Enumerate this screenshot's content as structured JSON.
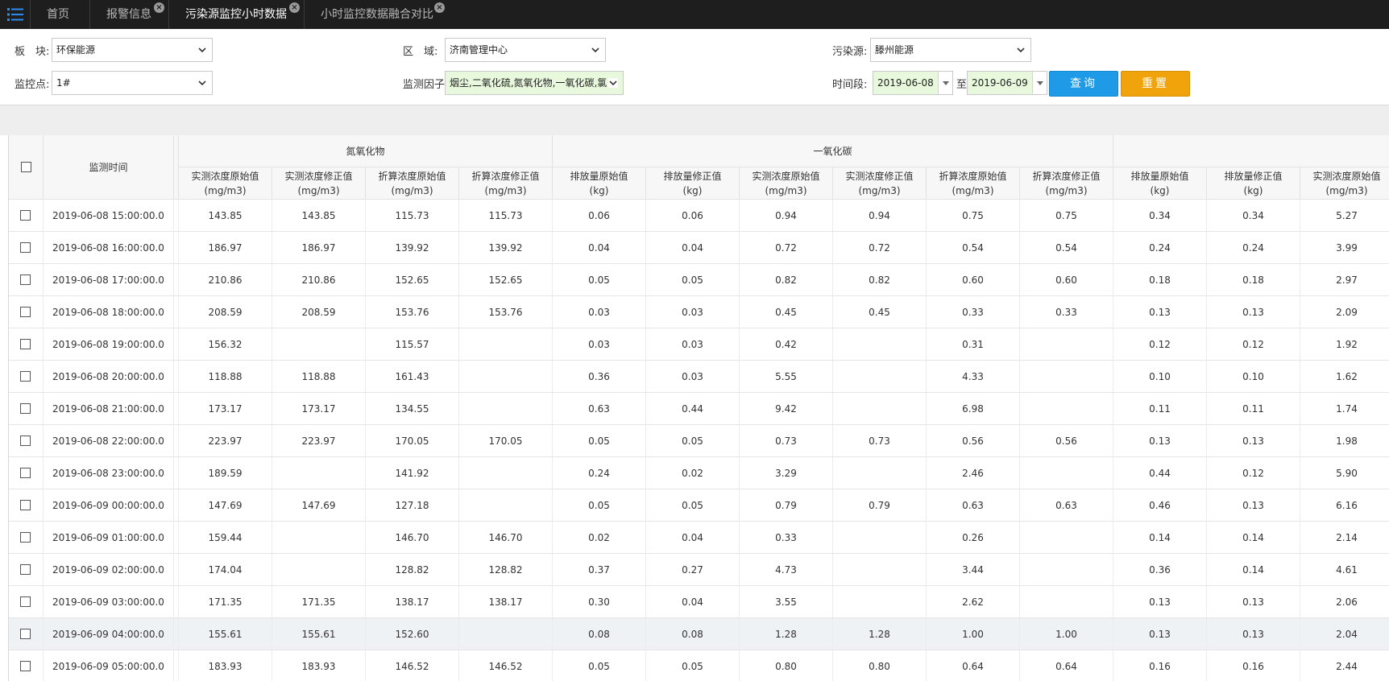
{
  "tabs": [
    {
      "label": "首页",
      "closable": false
    },
    {
      "label": "报警信息",
      "closable": true
    },
    {
      "label": "污染源监控小时数据",
      "closable": true,
      "active": true
    },
    {
      "label": "小时监控数据融合对比",
      "closable": true
    }
  ],
  "filters": {
    "plate_label": "板　块:",
    "plate_value": "环保能源",
    "region_label": "区　域:",
    "region_value": "济南管理中心",
    "source_label": "污染源:",
    "source_value": "滕州能源",
    "point_label": "监控点:",
    "point_value": "1#",
    "factor_label": "监测因子:",
    "factor_value": "烟尘,二氧化硫,氮氧化物,一氧化碳,氯",
    "time_label": "时间段:",
    "date_from": "2019-06-08",
    "date_to_label": "至",
    "date_to": "2019-06-09",
    "query_btn": "查询",
    "reset_btn": "重置"
  },
  "table": {
    "time_header": "监测时间",
    "groups": [
      {
        "name": "氮氧化物"
      },
      {
        "name": "一氧化碳"
      }
    ],
    "columns": [
      {
        "l1": "实测浓度原始值",
        "l2": "(mg/m3)"
      },
      {
        "l1": "实测浓度修正值",
        "l2": "(mg/m3)"
      },
      {
        "l1": "折算浓度原始值",
        "l2": "(mg/m3)"
      },
      {
        "l1": "折算浓度修正值",
        "l2": "(mg/m3)"
      },
      {
        "l1": "排放量原始值",
        "l2": "(kg)"
      },
      {
        "l1": "排放量修正值",
        "l2": "(kg)"
      },
      {
        "l1": "实测浓度原始值",
        "l2": "(mg/m3)"
      },
      {
        "l1": "实测浓度修正值",
        "l2": "(mg/m3)"
      },
      {
        "l1": "折算浓度原始值",
        "l2": "(mg/m3)"
      },
      {
        "l1": "折算浓度修正值",
        "l2": "(mg/m3)"
      },
      {
        "l1": "排放量原始值",
        "l2": "(kg)"
      },
      {
        "l1": "排放量修正值",
        "l2": "(kg)"
      },
      {
        "l1": "实测浓度原始值",
        "l2": "(mg/m3)"
      }
    ],
    "rows": [
      {
        "time": "2019-06-08 15:00:00.0",
        "v": [
          "143.85",
          "143.85",
          "115.73",
          "115.73",
          "0.06",
          "0.06",
          "0.94",
          "0.94",
          "0.75",
          "0.75",
          "0.34",
          "0.34",
          "5.27"
        ]
      },
      {
        "time": "2019-06-08 16:00:00.0",
        "v": [
          "186.97",
          "186.97",
          "139.92",
          "139.92",
          "0.04",
          "0.04",
          "0.72",
          "0.72",
          "0.54",
          "0.54",
          "0.24",
          "0.24",
          "3.99"
        ]
      },
      {
        "time": "2019-06-08 17:00:00.0",
        "v": [
          "210.86",
          "210.86",
          "152.65",
          "152.65",
          "0.05",
          "0.05",
          "0.82",
          "0.82",
          "0.60",
          "0.60",
          "0.18",
          "0.18",
          "2.97"
        ]
      },
      {
        "time": "2019-06-08 18:00:00.0",
        "v": [
          "208.59",
          "208.59",
          "153.76",
          "153.76",
          "0.03",
          "0.03",
          "0.45",
          "0.45",
          "0.33",
          "0.33",
          "0.13",
          "0.13",
          "2.09"
        ]
      },
      {
        "time": "2019-06-08 19:00:00.0",
        "v": [
          "156.32",
          "",
          "115.57",
          "",
          "0.03",
          "0.03",
          "0.42",
          "",
          "0.31",
          "",
          "0.12",
          "0.12",
          "1.92"
        ]
      },
      {
        "time": "2019-06-08 20:00:00.0",
        "v": [
          "118.88",
          "118.88",
          "161.43",
          "",
          "0.36",
          "0.03",
          "5.55",
          "",
          "4.33",
          "",
          "0.10",
          "0.10",
          "1.62"
        ]
      },
      {
        "time": "2019-06-08 21:00:00.0",
        "v": [
          "173.17",
          "173.17",
          "134.55",
          "",
          "0.63",
          "0.44",
          "9.42",
          "",
          "6.98",
          "",
          "0.11",
          "0.11",
          "1.74"
        ]
      },
      {
        "time": "2019-06-08 22:00:00.0",
        "v": [
          "223.97",
          "223.97",
          "170.05",
          "170.05",
          "0.05",
          "0.05",
          "0.73",
          "0.73",
          "0.56",
          "0.56",
          "0.13",
          "0.13",
          "1.98"
        ]
      },
      {
        "time": "2019-06-08 23:00:00.0",
        "v": [
          "189.59",
          "",
          "141.92",
          "",
          "0.24",
          "0.02",
          "3.29",
          "",
          "2.46",
          "",
          "0.44",
          "0.12",
          "5.90"
        ]
      },
      {
        "time": "2019-06-09 00:00:00.0",
        "v": [
          "147.69",
          "147.69",
          "127.18",
          "",
          "0.05",
          "0.05",
          "0.79",
          "0.79",
          "0.63",
          "0.63",
          "0.46",
          "0.13",
          "6.16"
        ]
      },
      {
        "time": "2019-06-09 01:00:00.0",
        "v": [
          "159.44",
          "",
          "146.70",
          "146.70",
          "0.02",
          "0.04",
          "0.33",
          "",
          "0.26",
          "",
          "0.14",
          "0.14",
          "2.14"
        ]
      },
      {
        "time": "2019-06-09 02:00:00.0",
        "v": [
          "174.04",
          "",
          "128.82",
          "128.82",
          "0.37",
          "0.27",
          "4.73",
          "",
          "3.44",
          "",
          "0.36",
          "0.14",
          "4.61"
        ]
      },
      {
        "time": "2019-06-09 03:00:00.0",
        "v": [
          "171.35",
          "171.35",
          "138.17",
          "138.17",
          "0.30",
          "0.04",
          "3.55",
          "",
          "2.62",
          "",
          "0.13",
          "0.13",
          "2.06"
        ]
      },
      {
        "time": "2019-06-09 04:00:00.0",
        "v": [
          "155.61",
          "155.61",
          "152.60",
          "",
          "0.08",
          "0.08",
          "1.28",
          "1.28",
          "1.00",
          "1.00",
          "0.13",
          "0.13",
          "2.04"
        ],
        "highlight": true
      },
      {
        "time": "2019-06-09 05:00:00.0",
        "v": [
          "183.93",
          "183.93",
          "146.52",
          "146.52",
          "0.05",
          "0.05",
          "0.80",
          "0.80",
          "0.64",
          "0.64",
          "0.16",
          "0.16",
          "2.44"
        ]
      }
    ]
  },
  "colors": {
    "tabbar_bg": "#1e1e1e",
    "query_btn": "#1e9ae6",
    "reset_btn": "#f0a30a",
    "highlight_row": "#eef2f4",
    "menu_icon": "#2d8cf0"
  }
}
